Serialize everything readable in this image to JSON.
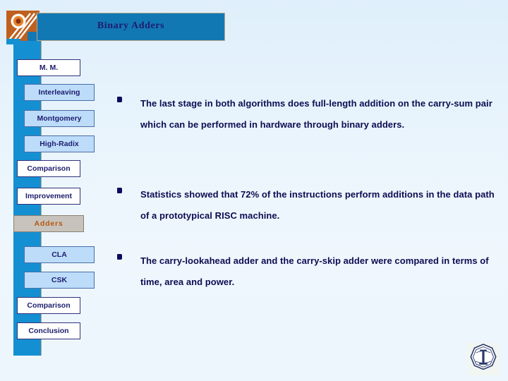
{
  "slide": {
    "title": "Binary Adders",
    "background_top_color": "#dfeffb",
    "background_bottom_color": "#edf6fd",
    "title_bar_color": "#1278b4",
    "title_text_color": "#1d1d6e"
  },
  "decoration": {
    "top_left_graphic": "sunburst-graphic",
    "top_left_colors": [
      "#c0601f",
      "#ffffff",
      "#e8832a"
    ],
    "bottom_right_emblem": "university-seal-emblem",
    "emblem_colors": [
      "#ffffff",
      "#2b3a6b"
    ]
  },
  "sidebar": {
    "bar_color": "#1490d2",
    "active_item_bg": "#c7c3bc",
    "active_item_color": "#b7560f",
    "items": [
      {
        "label": "M. M.",
        "level": 1,
        "active": false,
        "icon": "nav-item-icon"
      },
      {
        "label": "Interleaving",
        "level": 2,
        "active": false,
        "icon": "nav-item-icon"
      },
      {
        "label": "Montgomery",
        "level": 2,
        "active": false,
        "icon": "nav-item-icon"
      },
      {
        "label": "High-Radix",
        "level": 2,
        "active": false,
        "icon": "nav-item-icon"
      },
      {
        "label": "Comparison",
        "level": 1,
        "active": false,
        "icon": "nav-item-icon"
      },
      {
        "label": "Improvement",
        "level": 1,
        "active": false,
        "icon": "nav-item-icon"
      },
      {
        "label": "Adders",
        "level": 1,
        "active": true,
        "icon": "nav-item-icon"
      },
      {
        "label": "CLA",
        "level": 2,
        "active": false,
        "icon": "nav-item-icon"
      },
      {
        "label": "CSK",
        "level": 2,
        "active": false,
        "icon": "nav-item-icon"
      },
      {
        "label": "Comparison",
        "level": 1,
        "active": false,
        "icon": "nav-item-icon"
      },
      {
        "label": "Conclusion",
        "level": 1,
        "active": false,
        "icon": "nav-item-icon"
      }
    ]
  },
  "content": {
    "bullet_glyph": "square-bullet-icon",
    "bullets": [
      "The last stage in both algorithms does full-length addition on the carry-sum pair which can be performed in hardware through binary adders.",
      "Statistics showed that 72% of the instructions perform additions in the data path of a prototypical RISC machine.",
      "The carry-lookahead adder and the carry-skip adder were compared in terms of time, area and power."
    ]
  }
}
